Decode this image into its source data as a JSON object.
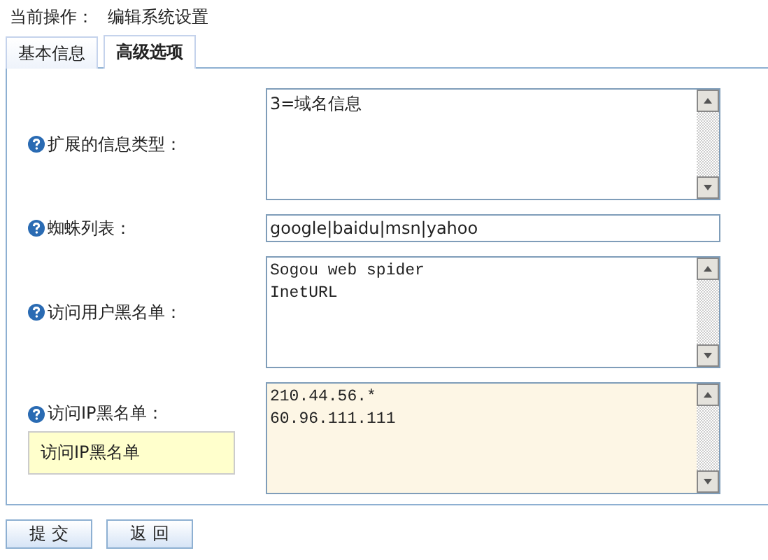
{
  "breadcrumb": {
    "label": "当前操作：",
    "value": "编辑系统设置"
  },
  "tabs": [
    {
      "label": "基本信息",
      "selected": false
    },
    {
      "label": "高级选项",
      "selected": true
    }
  ],
  "fields": [
    {
      "label": "扩展的信息类型：",
      "kind": "textarea",
      "value": "3=域名信息",
      "focused": false
    },
    {
      "label": "蜘蛛列表：",
      "kind": "input",
      "value": "google|baidu|msn|yahoo",
      "focused": false
    },
    {
      "label": "访问用户黑名单：",
      "kind": "code",
      "value": "Sogou web spider\nInetURL",
      "focused": false
    },
    {
      "label": "访问IP黑名单：",
      "kind": "code",
      "value": "210.44.56.*\n60.96.111.111",
      "focused": true,
      "tooltip": "访问IP黑名单"
    }
  ],
  "buttons": [
    "提 交",
    "返 回"
  ]
}
